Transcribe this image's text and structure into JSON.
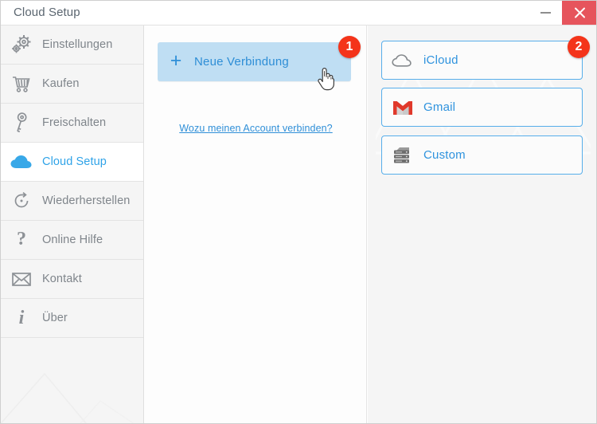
{
  "window": {
    "title": "Cloud Setup",
    "minimize_label": "Minimize",
    "close_label": "Close"
  },
  "colors": {
    "accent_blue": "#2f93de",
    "active_blue": "#2fa3e8",
    "badge_red": "#f4341a",
    "close_red": "#e6545c",
    "sidebar_bg": "#f5f5f5",
    "button_bg": "#bfdef3",
    "gmail_red": "#e0392b"
  },
  "sidebar": {
    "items": [
      {
        "label": "Einstellungen",
        "icon": "gears-icon",
        "active": false
      },
      {
        "label": "Kaufen",
        "icon": "shopping-cart-icon",
        "active": false
      },
      {
        "label": "Freischalten",
        "icon": "key-icon",
        "active": false
      },
      {
        "label": "Cloud Setup",
        "icon": "cloud-icon",
        "active": true
      },
      {
        "label": "Wiederherstellen",
        "icon": "restore-icon",
        "active": false
      },
      {
        "label": "Online Hilfe",
        "icon": "question-mark-icon",
        "active": false
      },
      {
        "label": "Kontakt",
        "icon": "envelope-icon",
        "active": false
      },
      {
        "label": "Über",
        "icon": "info-icon",
        "active": false
      }
    ]
  },
  "middle": {
    "new_connection": {
      "label": "Neue Verbindung",
      "icon": "plus-icon"
    },
    "help_link": "Wozu meinen Account verbinden?",
    "cursor": "hand-pointer-cursor"
  },
  "providers": {
    "items": [
      {
        "label": "iCloud",
        "icon": "cloud-outline-icon"
      },
      {
        "label": "Gmail",
        "icon": "gmail-icon"
      },
      {
        "label": "Custom",
        "icon": "server-rack-icon"
      }
    ]
  },
  "badges": {
    "step_one": "1",
    "step_two": "2"
  }
}
